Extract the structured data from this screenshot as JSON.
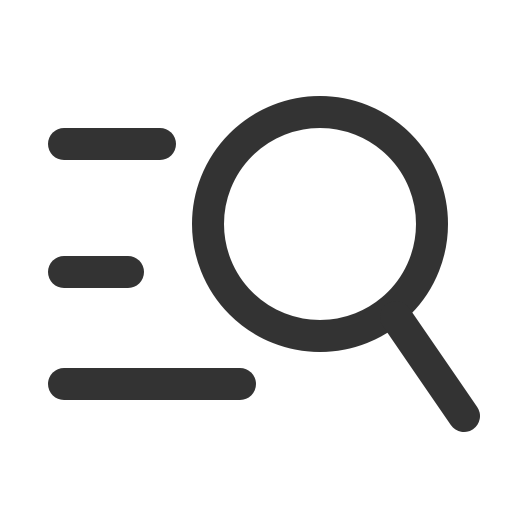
{
  "icon": {
    "name": "search-list-icon",
    "color": "#333333",
    "background": "#ffffff"
  }
}
